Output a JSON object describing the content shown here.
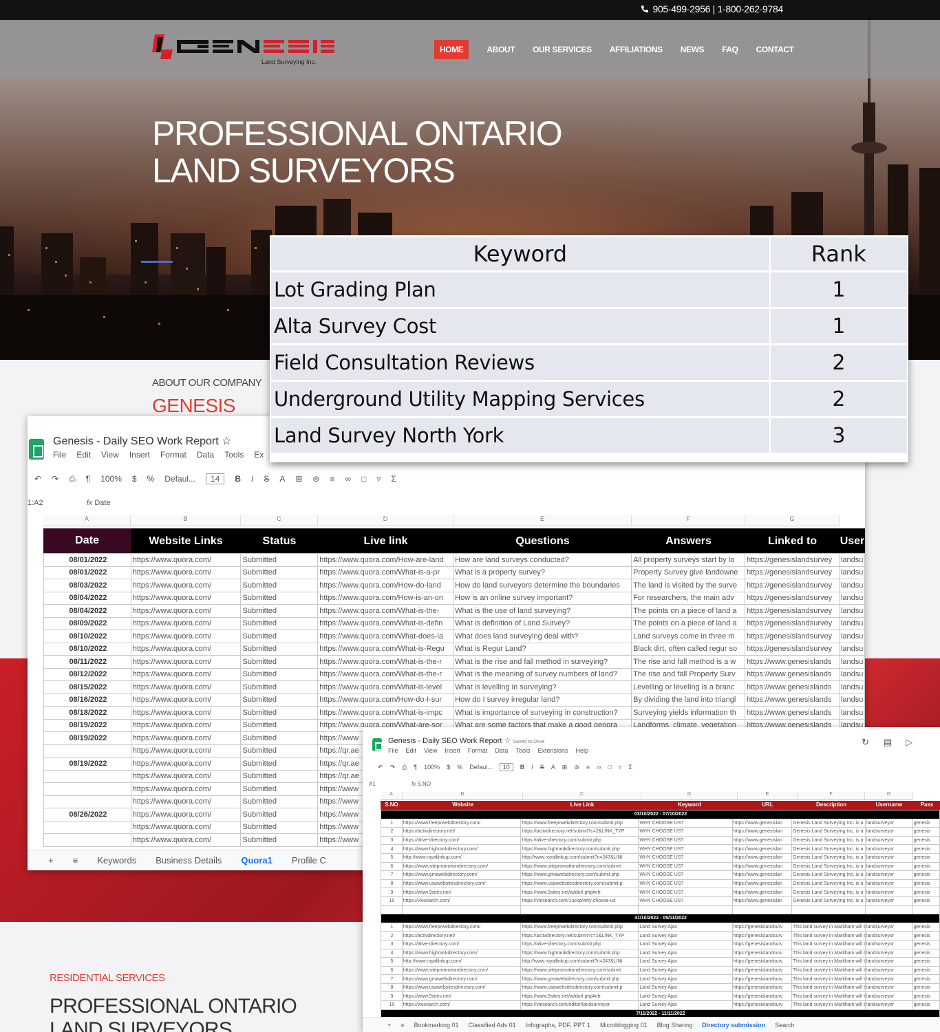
{
  "site": {
    "phone": "905-499-2956 | 1-800-262-9784",
    "logo_text": "GENESIS",
    "logo_tagline": "Land Surveying Inc.",
    "nav": [
      "HOME",
      "ABOUT",
      "OUR SERVICES",
      "AFFILIATIONS",
      "NEWS",
      "FAQ",
      "CONTACT"
    ],
    "active_nav": "HOME",
    "hero_title_1": "PROFESSIONAL ONTARIO",
    "hero_title_2": "LAND SURVEYORS",
    "about_label": "ABOUT OUR COMPANY",
    "about_brand": "GENESIS",
    "residential_label": "RESIDENTIAL SERVICES",
    "residential_title": "PROFESSIONAL ONTARIO LAND SURVEYORS",
    "accent_color": "#e23b32"
  },
  "keyword_table": {
    "headers": [
      "Keyword",
      "Rank"
    ],
    "rows": [
      {
        "keyword": "Lot Grading Plan",
        "rank": "1"
      },
      {
        "keyword": "Alta Survey Cost",
        "rank": "1"
      },
      {
        "keyword": "Field Consultation  Reviews",
        "rank": "2"
      },
      {
        "keyword": "Underground Utility Mapping Services",
        "rank": "2"
      },
      {
        "keyword": "Land Survey North York",
        "rank": "3"
      }
    ]
  },
  "sheet1": {
    "title": "Genesis - Daily SEO Work Report",
    "menu": [
      "File",
      "Edit",
      "View",
      "Insert",
      "Format",
      "Data",
      "Tools",
      "Ex"
    ],
    "zoom": "100%",
    "font": "Defaul...",
    "font_size": "14",
    "cell_ref": "1:A2",
    "formula": "Date",
    "col_letters": [
      "A",
      "B",
      "C",
      "D",
      "E",
      "F",
      "G"
    ],
    "headers": [
      "Date",
      "Website Links",
      "Status",
      "Live link",
      "Questions",
      "Answers",
      "Linked to",
      "User"
    ],
    "rows": [
      [
        "08/01/2022",
        "https://www.quora.com/",
        "Submitted",
        "https://www.quora.com/How-are-land",
        "How are land surveys conducted?",
        "All property surveys start by lo",
        "https://genesislandsurvey",
        "landsu"
      ],
      [
        "08/01/2022",
        "https://www.quora.com/",
        "Submitted",
        "https://www.quora.com/What-is-a-pr",
        "What is a property survey?",
        "Property Survey give landowne",
        "https://genesislandsurvey",
        "landsu"
      ],
      [
        "08/03/2022",
        "https://www.quora.com/",
        "Submitted",
        "https://www.quora.com/How-do-land",
        "How do land surveyors determine the boundaries",
        "The land is visited by the surve",
        "https://genesislandsurvey",
        "landsu"
      ],
      [
        "08/04/2022",
        "https://www.quora.com/",
        "Submitted",
        "https://www.quora.com/How-is-an-on",
        "How is an online survey important?",
        "For researchers, the main adv",
        "https://genesislandsurvey",
        "landsu"
      ],
      [
        "08/04/2022",
        "https://www.quora.com/",
        "Submitted",
        "https://www.quora.com/What-is-the-",
        "What is the use of land surveying?",
        "The points on a piece of land a",
        "https://genesislandsurvey",
        "landsu"
      ],
      [
        "08/09/2022",
        "https://www.quora.com/",
        "Submitted",
        "https://www.quora.com/What-is-defin",
        "What is definition of Land Survey?",
        "The points on a piece of land a",
        "https://genesislandsurvey",
        "landsu"
      ],
      [
        "08/10/2022",
        "https://www.quora.com/",
        "Submitted",
        "https://www.quora.com/What-does-la",
        "What does land surveying deal with?",
        "Land surveys come in three m",
        "https://genesislandsurvey",
        "landsu"
      ],
      [
        "08/10/2022",
        "https://www.quora.com/",
        "Submitted",
        "https://www.quora.com/What-is-Regu",
        "What is Regur Land?",
        "Black dirt, often called regur so",
        "https://genesislandsurvey",
        "landsu"
      ],
      [
        "08/11/2022",
        "https://www.quora.com/",
        "Submitted",
        "https://www.quora.com/What-is-the-r",
        "What is the rise and fall method in surveying?",
        "The rise and fall method is a w",
        "https://www.genesislands",
        "landsu"
      ],
      [
        "08/12/2022",
        "https://www.quora.com/",
        "Submitted",
        "https://www.quora.com/What-is-the-r",
        "What is the meaning of survey numbers of land?",
        "The rise and fall Property Surv",
        "https://www.genesislands",
        "landsu"
      ],
      [
        "08/15/2022",
        "https://www.quora.com/",
        "Submitted",
        "https://www.quora.com/What-is-level",
        "What is levelling in surveying?",
        "Levelling or leveling is a branc",
        "https://www.genesislands",
        "landsu"
      ],
      [
        "08/16/2022",
        "https://www.quora.com/",
        "Submitted",
        "https://www.quora.com/How-do-I-sur",
        "How do I survey irregular land?",
        "By dividing the land into triangl",
        "https://www.genesislands",
        "landsu"
      ],
      [
        "08/18/2022",
        "https://www.quora.com/",
        "Submitted",
        "https://www.quora.com/What-is-impc",
        "What is importance of surveying in construction?",
        "Surveying yields information th",
        "https://www.genesislands",
        "landsu"
      ],
      [
        "08/19/2022",
        "https://www.quora.com/",
        "Submitted",
        "https://www.quora.com/What-are-sor",
        "What are some factors that make a good geogra",
        "Landforms, climate, vegetation",
        "https://www.genesislands",
        "landsu"
      ],
      [
        "08/19/2022",
        "https://www.quora.com/",
        "Submitted",
        "https://www",
        "",
        "",
        "",
        ""
      ],
      [
        "",
        "https://www.quora.com/",
        "Submitted",
        "https://qr.ae",
        "",
        "",
        "",
        ""
      ],
      [
        "08/19/2022",
        "https://www.quora.com/",
        "Submitted",
        "https://qr.ae",
        "",
        "",
        "",
        ""
      ],
      [
        "",
        "https://www.quora.com/",
        "Submitted",
        "https://qr.ae",
        "",
        "",
        "",
        ""
      ],
      [
        "",
        "https://www.quora.com/",
        "Submitted",
        "https://www",
        "",
        "",
        "",
        ""
      ],
      [
        "",
        "https://www.quora.com/",
        "Submitted",
        "https://www",
        "",
        "",
        "",
        ""
      ],
      [
        "08/26/2022",
        "https://www.quora.com/",
        "Submitted",
        "https://www",
        "",
        "",
        "",
        ""
      ],
      [
        "",
        "https://www.quora.com/",
        "Submitted",
        "https://www",
        "",
        "",
        "",
        ""
      ],
      [
        "",
        "https://www.quora.com/",
        "Submitted",
        "https://www",
        "",
        "",
        "",
        ""
      ]
    ],
    "tabs": [
      "Keywords",
      "Business Details",
      "Quora1",
      "Profile C"
    ],
    "active_tab": "Quora1"
  },
  "sheet2": {
    "title": "Genesis - Daily SEO Work Report",
    "saved": "Saved to Drive",
    "menu": [
      "File",
      "Edit",
      "View",
      "Insert",
      "Format",
      "Data",
      "Tools",
      "Extensions",
      "Help"
    ],
    "zoom": "100%",
    "font": "Defaul...",
    "font_size": "10",
    "cell_ref": "A1",
    "formula": "S.NO",
    "col_letters": [
      "A",
      "B",
      "C",
      "D",
      "E",
      "F",
      "G"
    ],
    "headers": [
      "S.NO",
      "Website",
      "Live Link",
      "Keyword",
      "URL",
      "Description",
      "Username",
      "Pass"
    ],
    "week1": "03/10/2022 - 07/10/2022",
    "week2": "31/10/2022 - 05/11/2022",
    "week3": "7/11/2022 - 11/11/2022",
    "sites": [
      [
        "1",
        "https://www.freeprwebdirectory.com/",
        "https://www.freeprwebdirectory.com/submit.php"
      ],
      [
        "2",
        "https://activdirectory.net/",
        "https://activdirectory.net/submit?c=2&LINK_TYP"
      ],
      [
        "3",
        "https://alive-directory.com/",
        "https://alive-directory.com/submit.php"
      ],
      [
        "4",
        "https://www.highrankdirectory.com/",
        "https://www.highrankdirectory.com/submit.php"
      ],
      [
        "5",
        "http://www.royallinkup.com/",
        "http://www.royallinkup.com/submit?c=247&LINI"
      ],
      [
        "6",
        "https://www.sitepromotiondirectory.com/",
        "https://www.sitepromotiondirectory.com/submit"
      ],
      [
        "7",
        "https://www.gmawebdirectory.com/",
        "https://www.gmawebdirectory.com/submit.php"
      ],
      [
        "8",
        "https://www.usawebsitesdirectory.com/",
        "https://www.usawebsitesdirectory.com/submit.p"
      ],
      [
        "9",
        "https://www.9sites.net/",
        "https://www.9sites.net/addurl.php#cfr"
      ],
      [
        "10",
        "https://viesearch.com/",
        "https://viesearch.com/1uckp/why-choose-us"
      ]
    ],
    "week1_keyword": "WHY CHOOSE US?",
    "week1_url": "https://www.genesislan",
    "week1_desc": "Genesis Land Surveying Inc. is a",
    "week2_keyword": "Land Survey Ajax",
    "week2_url": "https://genesislandsurv",
    "week2_desc": "This land survey in Markham will t",
    "week2_last_link": "https://viesearch.com/editor/landsurveyor",
    "username": "landsurveyor",
    "pass": "genesis",
    "tabs": [
      "Bookmarking 01",
      "Classified Ads 01",
      "Infographs, PDF, PPT 1",
      "Microblogging 01",
      "Blog Sharing",
      "Directory submission",
      "Search"
    ],
    "active_tab": "Directory submission"
  }
}
